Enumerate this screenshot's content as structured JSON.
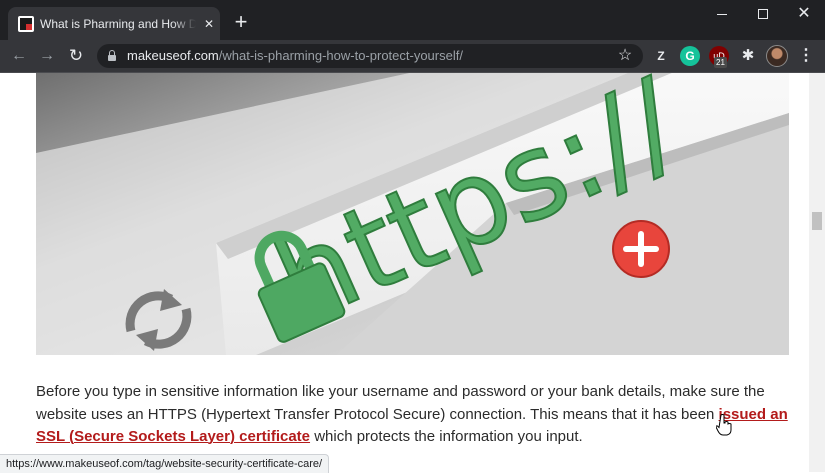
{
  "tab": {
    "title": "What is Pharming and How Do You Protect Yourself?",
    "close_glyph": "✕"
  },
  "new_tab_glyph": "+",
  "window_controls": {
    "close_glyph": "✕"
  },
  "toolbar": {
    "back_glyph": "←",
    "forward_glyph": "→",
    "reload_glyph": "↻",
    "url_host": "makeuseof.com",
    "url_path": "/what-is-pharming-how-to-protect-yourself/",
    "star_glyph": "☆",
    "menu_glyph": "⋮"
  },
  "extensions": {
    "z_label": "Z",
    "grammarly_label": "G",
    "ublock_label": "uD",
    "ublock_badge": "21",
    "puzzle_glyph": "✱"
  },
  "hero": {
    "https_text": "https://"
  },
  "article": {
    "text_before": "Before you type in sensitive information like your username and password or your bank details, make sure the website uses an HTTPS (Hypertext Transfer Protocol Secure) connection. This means that it has been ",
    "link_text": "issued an SSL (Secure Sockets Layer) certificate",
    "text_after": " which protects the information you input."
  },
  "status_bar": {
    "url": "https://www.makeuseof.com/tag/website-security-certificate-care/"
  },
  "colors": {
    "chrome_dark": "#202124",
    "toolbar": "#35363a",
    "link": "#b31b1b",
    "https_green": "#4ea862",
    "close_red": "#e8453c"
  }
}
